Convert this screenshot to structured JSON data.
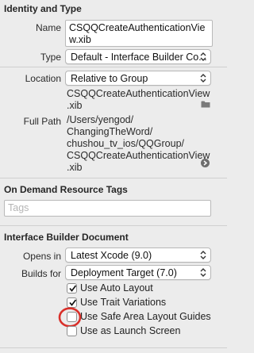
{
  "identity": {
    "title": "Identity and Type",
    "name_label": "Name",
    "name_value": "CSQQCreateAuthenticationView.xib",
    "type_label": "Type",
    "type_value": "Default - Interface Builder Co...",
    "location_label": "Location",
    "location_value": "Relative to Group",
    "location_path": [
      "CSQQCreateAuthenticationView",
      ".xib"
    ],
    "fullpath_label": "Full Path",
    "fullpath_lines": [
      "/Users/yengod/",
      "ChangingTheWord/",
      "chushou_tv_ios/QQGroup/",
      "CSQQCreateAuthenticationView",
      ".xib"
    ]
  },
  "tags": {
    "title": "On Demand Resource Tags",
    "placeholder": "Tags"
  },
  "ib_document": {
    "title": "Interface Builder Document",
    "opens_in_label": "Opens in",
    "opens_in_value": "Latest Xcode (9.0)",
    "builds_for_label": "Builds for",
    "builds_for_value": "Deployment Target (7.0)",
    "options": [
      {
        "label": "Use Auto Layout",
        "checked": true
      },
      {
        "label": "Use Trait Variations",
        "checked": true
      },
      {
        "label": "Use Safe Area Layout Guides",
        "checked": false
      },
      {
        "label": "Use as Launch Screen",
        "checked": false
      }
    ]
  },
  "colors": {
    "highlight_ring": "#d9302a",
    "panel_bg": "#ececec"
  }
}
